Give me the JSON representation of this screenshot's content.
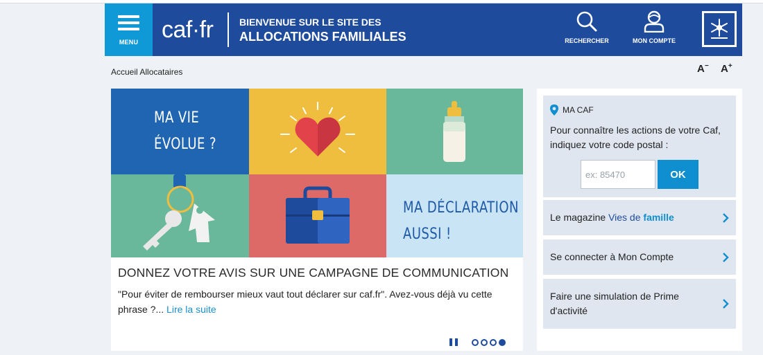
{
  "header": {
    "menu_label": "MENU",
    "logo_text": "caf·fr",
    "welcome_line1": "BIENVENUE SUR LE SITE DES",
    "welcome_line2": "ALLOCATIONS FAMILIALES",
    "search_label": "RECHERCHER",
    "account_label": "MON COMPTE",
    "brand_color": "#1e4b9c",
    "menu_color": "#0f9ad7"
  },
  "breadcrumb": "Accueil Allocataires",
  "font_controls": {
    "decrease": "A",
    "decrease_sign": "−",
    "increase": "A",
    "increase_sign": "+"
  },
  "slide": {
    "tile1_line1": "MA VIE",
    "tile1_line2": "ÉVOLUE ?",
    "tile6_line1": "MA DÉCLARATION",
    "tile6_line2": "AUSSI !",
    "title": "DONNEZ VOTRE AVIS SUR UNE CAMPAGNE DE COMMUNICATION",
    "text": "\"Pour éviter de rembourser mieux vaut tout déclarer sur caf.fr\". Avez-vous déjà vu cette phrase ?...",
    "read_more": "Lire la suite",
    "pager": {
      "total": 4,
      "active": 4
    }
  },
  "sidebar": {
    "macaf_title": "MA CAF",
    "macaf_desc": "Pour connaître les actions de votre Caf, indiquez votre code postal :",
    "postal_placeholder": "ex: 85470",
    "ok_label": "OK",
    "magazine_prefix": "Le magazine ",
    "magazine_vies": "Vies de ",
    "magazine_famille": "famille",
    "link_moncompte": "Se connecter à Mon Compte",
    "link_simulation": "Faire une simulation de Prime d'activité"
  }
}
